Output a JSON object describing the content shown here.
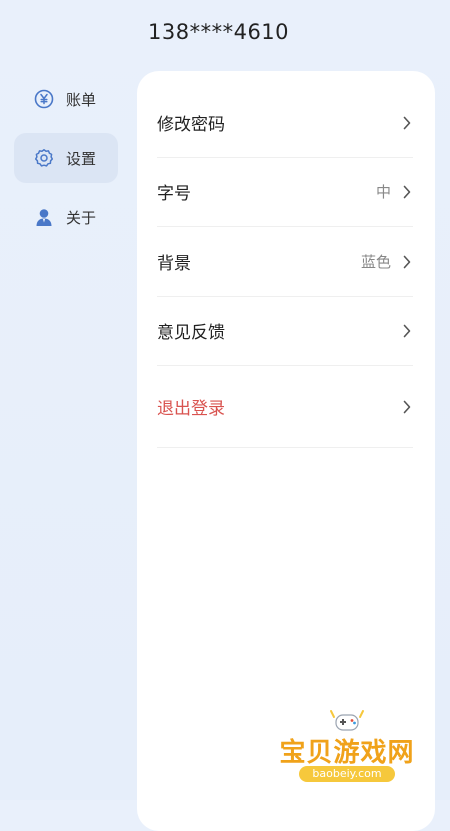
{
  "header": {
    "phone": "138****4610"
  },
  "sidebar": {
    "items": [
      {
        "label": "账单",
        "icon": "yen-icon",
        "active": false
      },
      {
        "label": "设置",
        "icon": "gear-icon",
        "active": true
      },
      {
        "label": "关于",
        "icon": "user-icon",
        "active": false
      }
    ]
  },
  "settings": {
    "rows": [
      {
        "label": "修改密码",
        "value": ""
      },
      {
        "label": "字号",
        "value": "中"
      },
      {
        "label": "背景",
        "value": "蓝色"
      },
      {
        "label": "意见反馈",
        "value": ""
      },
      {
        "label": "退出登录",
        "value": ""
      }
    ]
  },
  "watermark": {
    "title": "宝贝游戏网",
    "url": "baobeiy.com"
  },
  "colors": {
    "accent": "#4a78c8",
    "logout": "#d9534f",
    "active_bg": "#dbe5f4"
  }
}
